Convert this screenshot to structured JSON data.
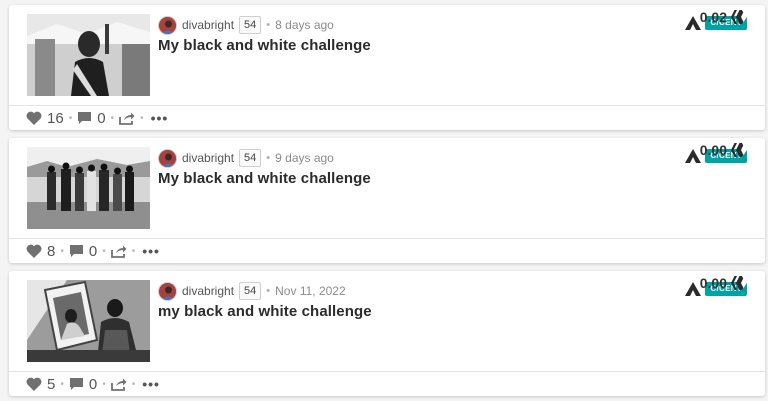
{
  "posts": [
    {
      "author": "divabright",
      "reputation": "54",
      "time": "8 days ago",
      "title": "My black and white challenge",
      "community_tag": "C/CENT",
      "likes": "16",
      "comments": "0",
      "payout": "0.02"
    },
    {
      "author": "divabright",
      "reputation": "54",
      "time": "9 days ago",
      "title": "My black and white challenge",
      "community_tag": "C/CENT",
      "likes": "8",
      "comments": "0",
      "payout": "0.00"
    },
    {
      "author": "divabright",
      "reputation": "54",
      "time": "Nov 11, 2022",
      "title": "my black and white challenge",
      "community_tag": "C/CENT",
      "likes": "5",
      "comments": "0",
      "payout": "0.00"
    }
  ],
  "icons": {
    "like": "heart-icon",
    "comment": "comment-icon",
    "reblog": "share-icon",
    "more": "more-icon",
    "currency": "hive-icon",
    "community": "community-icon"
  },
  "colors": {
    "tag_background": "#00a3a3",
    "card_background": "#ffffff",
    "page_background": "#f4f4f4"
  }
}
